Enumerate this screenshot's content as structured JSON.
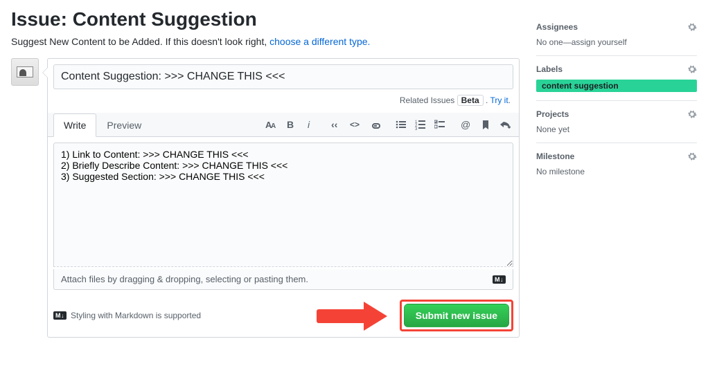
{
  "page": {
    "title": "Issue: Content Suggestion",
    "subtitle_prefix": "Suggest New Content to be Added. If this doesn't look right, ",
    "subtitle_link": "choose a different type.",
    "issue_title_value": "Content Suggestion: >>> CHANGE THIS <<<",
    "related_label": "Related Issues",
    "beta_label": "Beta",
    "try_it": "Try it",
    "tab_write": "Write",
    "tab_preview": "Preview",
    "body_value": "1) Link to Content: >>> CHANGE THIS <<<\n2) Briefly Describe Content: >>> CHANGE THIS <<<\n3) Suggested Section: >>> CHANGE THIS <<<",
    "attach_hint": "Attach files by dragging & dropping, selecting or pasting them.",
    "md_badge": "M↓",
    "md_help": "Styling with Markdown is supported",
    "submit_label": "Submit new issue"
  },
  "sidebar": {
    "assignees": {
      "title": "Assignees",
      "body": "No one—assign yourself"
    },
    "labels": {
      "title": "Labels",
      "chip": "content suggestion"
    },
    "projects": {
      "title": "Projects",
      "body": "None yet"
    },
    "milestone": {
      "title": "Milestone",
      "body": "No milestone"
    }
  }
}
